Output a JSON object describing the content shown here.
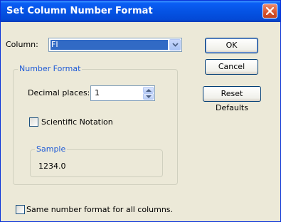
{
  "window": {
    "title": "Set Column Number Format"
  },
  "column": {
    "label": "Column:",
    "selected": "FI"
  },
  "buttons": {
    "ok": "OK",
    "cancel": "Cancel",
    "reset": "Reset Defaults"
  },
  "number_format": {
    "legend": "Number Format",
    "decimal_label": "Decimal places:",
    "decimal_value": "1",
    "scientific_label": "Scientific Notation",
    "scientific_checked": false,
    "sample_legend": "Sample",
    "sample_value": "1234.0"
  },
  "same_format": {
    "label": "Same number format for all columns.",
    "checked": false
  },
  "colors": {
    "title_bar": "#0553e4",
    "selection": "#316ac5",
    "legend_text": "#1f5bd6",
    "dialog_bg": "#ece9d8"
  }
}
